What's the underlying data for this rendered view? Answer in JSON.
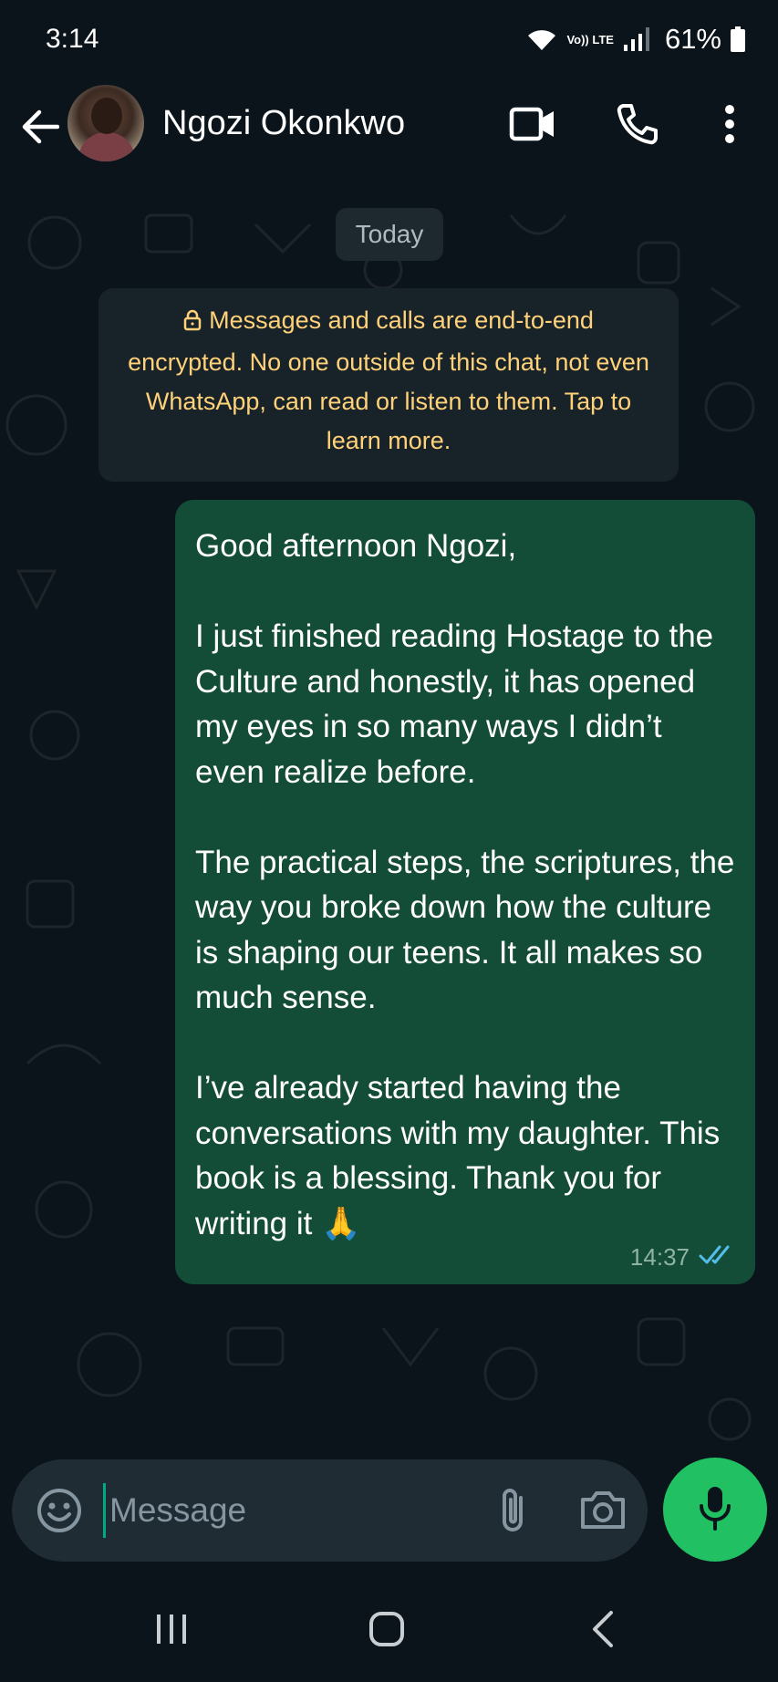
{
  "status_bar": {
    "time": "3:14",
    "network_label": "Vo)) LTE",
    "battery": "61%"
  },
  "header": {
    "contact_name": "Ngozi Okonkwo",
    "icons": [
      "back-arrow-icon",
      "video-call-icon",
      "phone-icon",
      "more-vert-icon"
    ]
  },
  "chat": {
    "date_label": "Today",
    "encryption_notice": "Messages and calls are end-to-end encrypted. No one outside of this chat, not even WhatsApp, can read or listen to them. Tap to learn more.",
    "messages": [
      {
        "direction": "outgoing",
        "text": "Good afternoon Ngozi,\n\nI just finished reading Hostage to the Culture and honestly, it has opened my eyes in so many ways I didn’t even realize before.\n\nThe practical steps, the scriptures, the way you broke down how the culture is shaping our teens. It all makes so much sense.\n\nI’ve already started having the conversations with my daughter. This book is a blessing. Thank you for writing it 🙏",
        "time": "14:37",
        "status": "read"
      }
    ]
  },
  "composer": {
    "placeholder": "Message",
    "value": ""
  },
  "colors": {
    "background": "#0b141a",
    "bubble_outgoing": "#144d37",
    "notice_text": "#ffd279",
    "read_ticks": "#53bdeb",
    "mic_button": "#21c063"
  }
}
